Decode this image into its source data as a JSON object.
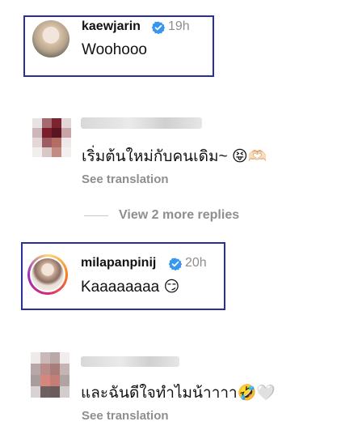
{
  "comments": [
    {
      "username": "kaewjarin",
      "time": "19h",
      "text": "Woohooo",
      "verified": true
    },
    {
      "username": "",
      "text": "เริ่มต้นใหม่กับคนเดิม~ 😝🫶🏻",
      "translation_label": "See translation"
    },
    {
      "username": "milapanpinij",
      "time": "20h",
      "text": "Kaaaaaaaa 😏",
      "verified": true
    },
    {
      "username": "",
      "text": "และฉันดีใจทำไมน้าาาา🤣🤍",
      "translation_label": "See translation"
    }
  ],
  "view_more_replies": "View 2 more replies",
  "colors": {
    "verified_blue": "#3797f0",
    "secondary_text": "#8e8e8e",
    "highlight_border": "#2b2f9e"
  }
}
